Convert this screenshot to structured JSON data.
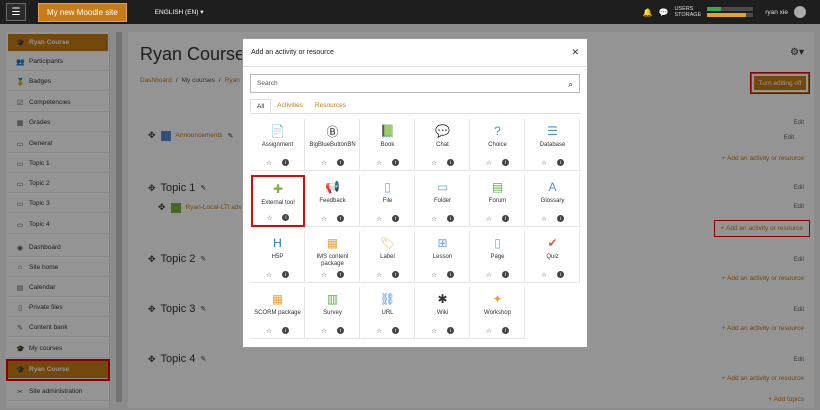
{
  "navbar": {
    "site_name": "My new Moodle site",
    "language": "ENGLISH (EN)",
    "users_label": "USERS",
    "storage_label": "STORAGE",
    "users_fill": 0.3,
    "storage_fill": 0.85,
    "user_name": "ryan xie"
  },
  "sidebar": {
    "items": [
      {
        "label": "Ryan Course",
        "icon": "graduation-cap-icon"
      },
      {
        "label": "Participants",
        "icon": "users-icon"
      },
      {
        "label": "Badges",
        "icon": "badge-icon"
      },
      {
        "label": "Competencies",
        "icon": "check-square-icon"
      },
      {
        "label": "Grades",
        "icon": "table-icon"
      },
      {
        "label": "General",
        "icon": "folder-icon"
      },
      {
        "label": "Topic 1",
        "icon": "folder-icon"
      },
      {
        "label": "Topic 2",
        "icon": "folder-icon"
      },
      {
        "label": "Topic 3",
        "icon": "folder-icon"
      },
      {
        "label": "Topic 4",
        "icon": "folder-icon"
      },
      {
        "label": "Dashboard",
        "icon": "dashboard-icon"
      },
      {
        "label": "Site home",
        "icon": "home-icon"
      },
      {
        "label": "Calendar",
        "icon": "calendar-icon"
      },
      {
        "label": "Private files",
        "icon": "file-icon"
      },
      {
        "label": "Content bank",
        "icon": "brush-icon"
      },
      {
        "label": "My courses",
        "icon": "graduation-cap-icon"
      },
      {
        "label": "Ryan Course",
        "icon": "graduation-cap-icon"
      },
      {
        "label": "Site administration",
        "icon": "wrench-icon"
      }
    ]
  },
  "course": {
    "title": "Ryan Course",
    "breadcrumb": [
      "Dashboard",
      "My courses",
      "Ryan C"
    ],
    "turn_editing": "Turn editing off",
    "announcements": "Announcements",
    "edit": "Edit",
    "add_activity": "+ Add an activity or resource",
    "add_topics": "+ Add topics",
    "topics": [
      "Topic 1",
      "Topic 2",
      "Topic 3",
      "Topic 4"
    ],
    "lti_activity": "Ryan-Local-LTI advan"
  },
  "modal": {
    "title": "Add an activity or resource",
    "search_placeholder": "Search",
    "tabs": [
      "All",
      "Activities",
      "Resources"
    ],
    "tiles": [
      {
        "name": "Assignment",
        "icon": "assignment-icon",
        "color": "#5b8bd6"
      },
      {
        "name": "BigBlueButtonBN",
        "icon": "bigbluebutton-icon",
        "color": "#222222"
      },
      {
        "name": "Book",
        "icon": "book-icon",
        "color": "#6aa84f"
      },
      {
        "name": "Chat",
        "icon": "chat-icon",
        "color": "#e8a33a"
      },
      {
        "name": "Choice",
        "icon": "choice-icon",
        "color": "#4a90d9"
      },
      {
        "name": "Database",
        "icon": "database-icon",
        "color": "#4a90d9"
      },
      {
        "name": "External tool",
        "icon": "puzzle-icon",
        "color": "#7cb342"
      },
      {
        "name": "Feedback",
        "icon": "feedback-icon",
        "color": "#e06030"
      },
      {
        "name": "File",
        "icon": "file-icon",
        "color": "#6fa8dc"
      },
      {
        "name": "Folder",
        "icon": "folder-icon",
        "color": "#6fa8dc"
      },
      {
        "name": "Forum",
        "icon": "forum-icon",
        "color": "#6aa84f"
      },
      {
        "name": "Glossary",
        "icon": "glossary-icon",
        "color": "#4a90d9"
      },
      {
        "name": "H5P",
        "icon": "h5p-icon",
        "color": "#1a73e8"
      },
      {
        "name": "IMS content package",
        "icon": "ims-icon",
        "color": "#e8a33a"
      },
      {
        "name": "Label",
        "icon": "label-icon",
        "color": "#e8c53a"
      },
      {
        "name": "Lesson",
        "icon": "lesson-icon",
        "color": "#6fa8dc"
      },
      {
        "name": "Page",
        "icon": "page-icon",
        "color": "#6fa8dc"
      },
      {
        "name": "Quiz",
        "icon": "quiz-icon",
        "color": "#e06030"
      },
      {
        "name": "SCORM package",
        "icon": "scorm-icon",
        "color": "#e8a33a"
      },
      {
        "name": "Survey",
        "icon": "survey-icon",
        "color": "#6aa84f"
      },
      {
        "name": "URL",
        "icon": "url-icon",
        "color": "#4a90d9"
      },
      {
        "name": "Wiki",
        "icon": "wiki-icon",
        "color": "#333333"
      },
      {
        "name": "Workshop",
        "icon": "workshop-icon",
        "color": "#e8a33a"
      }
    ]
  },
  "colors": {
    "accent": "#c77c18",
    "highlight": "#e00000"
  }
}
